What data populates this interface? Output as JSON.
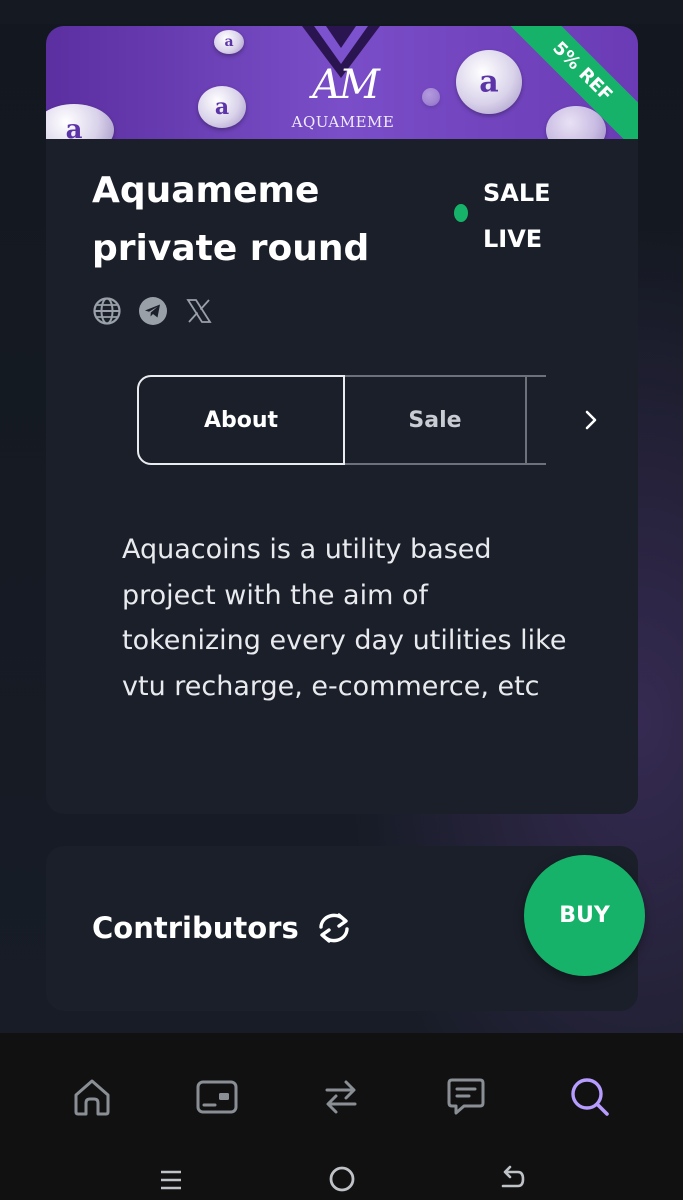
{
  "banner": {
    "logo_text": "AQUAMEME",
    "ribbon": "5% REF"
  },
  "project": {
    "title": "Aquameme private round",
    "status": "SALE LIVE",
    "status_color": "#17b26a"
  },
  "socials": [
    "globe-icon",
    "telegram-icon",
    "x-icon"
  ],
  "tabs": {
    "about": "About",
    "sale": "Sale"
  },
  "about": {
    "description": "Aquacoins is a utility based project with the aim of tokenizing every day utilities like vtu recharge, e-commerce, etc"
  },
  "contributors": {
    "title": "Contributors"
  },
  "buy_button": "BUY",
  "bottom_nav": [
    "home-icon",
    "wallet-icon",
    "swap-icon",
    "chat-icon",
    "search-icon"
  ],
  "active_nav": "search-icon",
  "colors": {
    "accent_green": "#17b26a",
    "active_nav": "#b69cff",
    "banner_purple": "#6a3bb5"
  }
}
